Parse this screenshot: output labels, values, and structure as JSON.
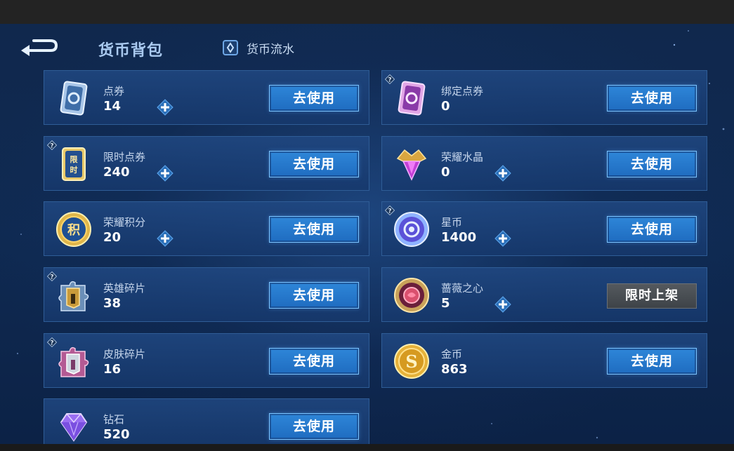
{
  "header": {
    "title": "货币背包",
    "flow_tab_label": "货币流水"
  },
  "colors": {
    "accent": "#2e86d8",
    "card_border": "#2f5d97",
    "disabled_button": "#4a4f54"
  },
  "items": [
    {
      "name": "点券",
      "count": "14",
      "icon": "ticket-card-icon",
      "help": false,
      "plus": true,
      "action": "去使用"
    },
    {
      "name": "绑定点券",
      "count": "0",
      "icon": "bound-ticket-card-icon",
      "help": true,
      "plus": false,
      "action": "去使用"
    },
    {
      "name": "限时点券",
      "count": "240",
      "icon": "limited-ticket-icon",
      "help": true,
      "plus": true,
      "action": "去使用"
    },
    {
      "name": "荣耀水晶",
      "count": "0",
      "icon": "glory-crystal-icon",
      "help": false,
      "plus": true,
      "action": "去使用"
    },
    {
      "name": "荣耀积分",
      "count": "20",
      "icon": "glory-points-coin-icon",
      "help": false,
      "plus": true,
      "action": "去使用"
    },
    {
      "name": "星币",
      "count": "1400",
      "icon": "star-coin-icon",
      "help": true,
      "plus": true,
      "action": "去使用"
    },
    {
      "name": "英雄碎片",
      "count": "38",
      "icon": "hero-fragment-icon",
      "help": true,
      "plus": false,
      "action": "去使用"
    },
    {
      "name": "蔷薇之心",
      "count": "5",
      "icon": "rose-heart-icon",
      "help": false,
      "plus": true,
      "action": "限时上架"
    },
    {
      "name": "皮肤碎片",
      "count": "16",
      "icon": "skin-fragment-icon",
      "help": true,
      "plus": false,
      "action": "去使用"
    },
    {
      "name": "金币",
      "count": "863",
      "icon": "gold-coin-icon",
      "help": false,
      "plus": false,
      "action": "去使用"
    },
    {
      "name": "钻石",
      "count": "520",
      "icon": "diamond-icon",
      "help": false,
      "plus": false,
      "action": "去使用"
    }
  ]
}
